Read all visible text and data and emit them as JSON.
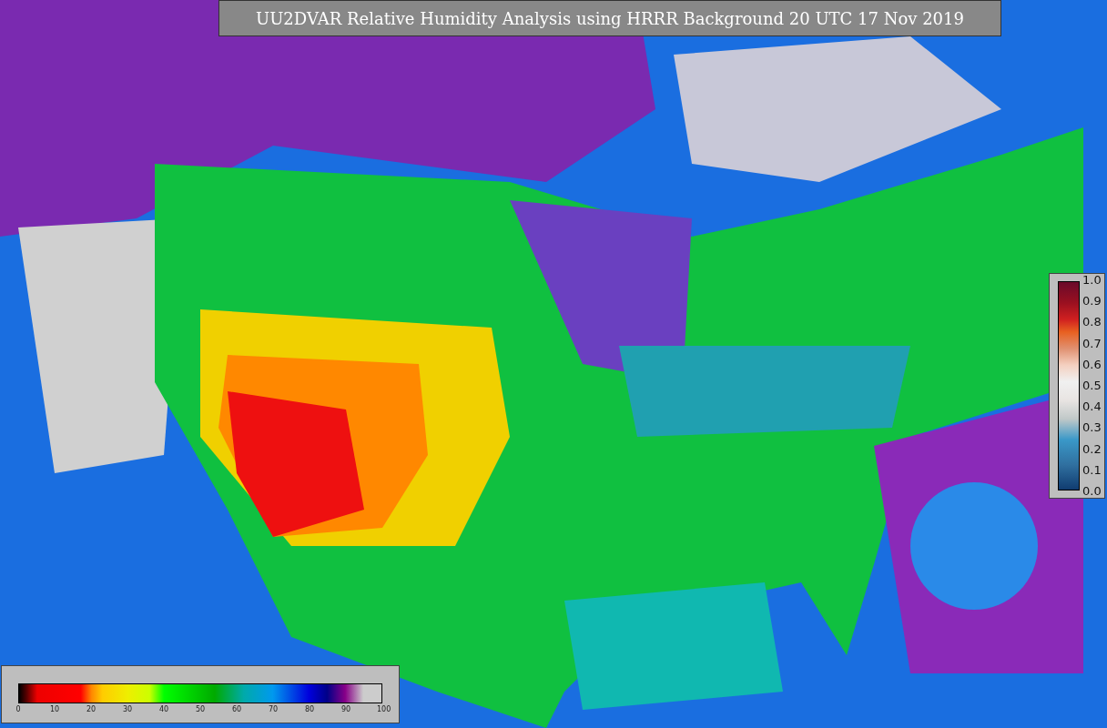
{
  "title": "UU2DVAR Relative Humidity Analysis using HRRR Background 20 UTC 17 Nov 2019",
  "humidity_colorbar": {
    "ticks": [
      "0",
      "10",
      "20",
      "30",
      "40",
      "50",
      "60",
      "70",
      "80",
      "90",
      "100"
    ]
  },
  "station_colorbar": {
    "ticks": [
      "1.0",
      "0.9",
      "0.8",
      "0.7",
      "0.6",
      "0.5",
      "0.4",
      "0.3",
      "0.2",
      "0.1",
      "0.0"
    ]
  }
}
